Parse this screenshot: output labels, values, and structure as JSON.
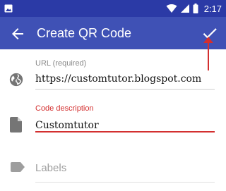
{
  "status_bar": {
    "time": "2:17"
  },
  "toolbar": {
    "title": "Create QR Code"
  },
  "form": {
    "url": {
      "label": "URL (required)",
      "value": "https://customtutor.blogspot.com"
    },
    "description": {
      "label": "Code description",
      "value": "Customtutor"
    },
    "labels": {
      "placeholder": "Labels"
    }
  },
  "colors": {
    "app_bar": "#3f51b5",
    "status_bar": "#2b3aa6",
    "accent_error": "#d32f2f"
  },
  "icons": {
    "status_left": "image-icon",
    "status_right": [
      "wifi-icon",
      "signal-icon",
      "battery-icon"
    ],
    "back": "arrow-back-icon",
    "confirm": "check-icon",
    "url": "globe-icon",
    "description": "document-icon",
    "labels": "label-tag-icon"
  }
}
